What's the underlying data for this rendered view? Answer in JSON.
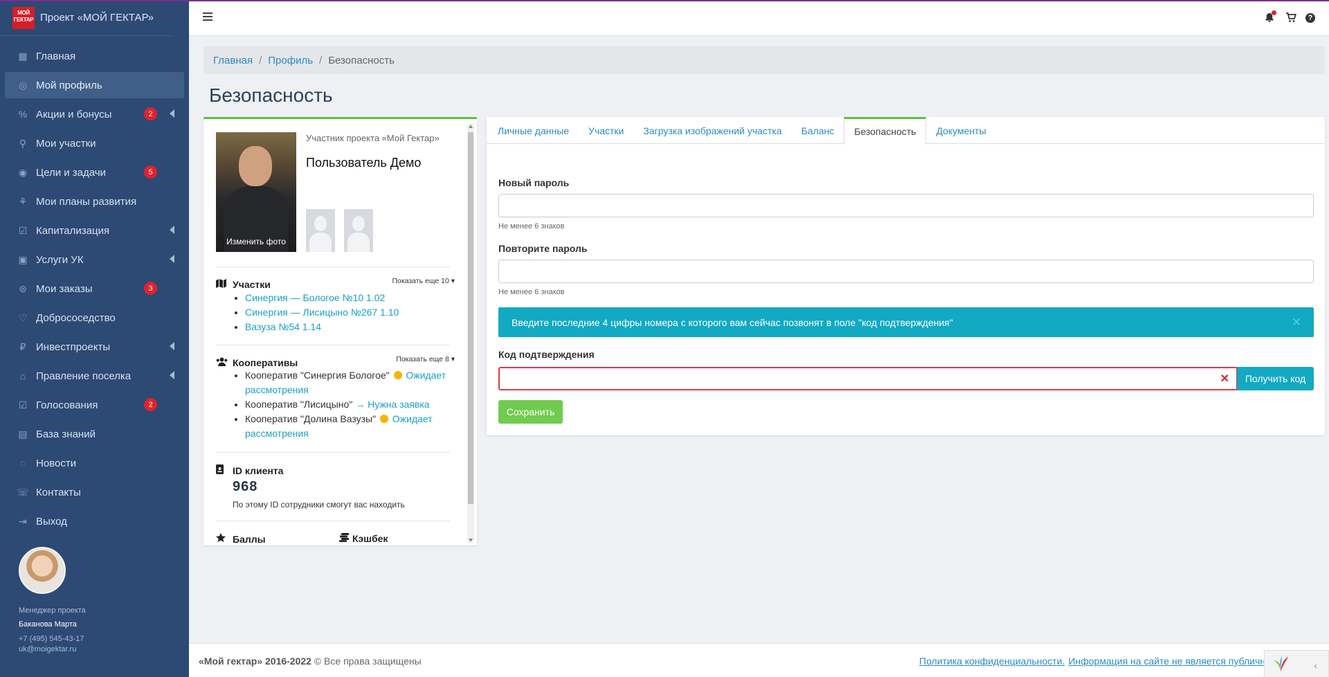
{
  "brand": {
    "title": "Проект «МОЙ ГЕКТАР»",
    "logo_text_1": "МОЙ",
    "logo_text_2": "ГЕКТАР",
    "logo_color": "#d51e28"
  },
  "sidebar": {
    "items": [
      {
        "label": "Главная",
        "icon": "grid-icon"
      },
      {
        "label": "Мой профиль",
        "icon": "user-circle-icon",
        "active": true
      },
      {
        "label": "Акции и бонусы",
        "icon": "percent-icon",
        "badge": "2",
        "chevron": true
      },
      {
        "label": "Мои участки",
        "icon": "map-pin-icon"
      },
      {
        "label": "Цели и задачи",
        "icon": "target-icon",
        "badge": "5"
      },
      {
        "label": "Мои планы развития",
        "icon": "growth-icon"
      },
      {
        "label": "Капитализация",
        "icon": "checkbox-icon",
        "chevron": true
      },
      {
        "label": "Услуги УК",
        "icon": "briefcase-icon",
        "chevron": true
      },
      {
        "label": "Мои заказы",
        "icon": "orders-icon",
        "badge": "3"
      },
      {
        "label": "Добрососедство",
        "icon": "handshake-icon"
      },
      {
        "label": "Инвестпроекты",
        "icon": "rouble-icon",
        "chevron": true
      },
      {
        "label": "Правление поселка",
        "icon": "building-icon",
        "chevron": true
      },
      {
        "label": "Голосования",
        "icon": "vote-icon",
        "badge": "2"
      },
      {
        "label": "База знаний",
        "icon": "book-icon"
      },
      {
        "label": "Новости",
        "icon": "news-icon"
      },
      {
        "label": "Контакты",
        "icon": "phone-icon"
      },
      {
        "label": "Выход",
        "icon": "logout-icon"
      }
    ],
    "manager": {
      "role": "Менеджер проекта",
      "name": "Баканова Марта",
      "phone": "+7 (495) 545-43-17",
      "email": "uk@moigektar.ru"
    }
  },
  "header": {
    "icons": [
      "menu-icon",
      "bell-icon",
      "cart-icon",
      "help-icon"
    ]
  },
  "breadcrumb": {
    "items": [
      "Главная",
      "Профиль"
    ],
    "current": "Безопасность"
  },
  "page_title": "Безопасность",
  "profile": {
    "change_photo": "Изменить фото",
    "subtitle": "Участник проекта «Мой Гектар»",
    "name": "Пользователь Демо",
    "plots": {
      "title": "Участки",
      "show_more": "Показать еще 10",
      "items": [
        "Синергия — Бологое №10 1.02",
        "Синергия — Лисицыно №267 1.10",
        "Вазуза №54 1.14"
      ]
    },
    "coops": {
      "title": "Кооперативы",
      "show_more": "Показать еще 8",
      "items": [
        {
          "name": "Кооператив \"Синергия Бологое\"",
          "status": "Ожидает рассмотрения",
          "status_icon": "clock-icon"
        },
        {
          "name": "Кооператив \"Лисицыно\"",
          "status": "Нужна заявка",
          "status_icon": "arrow-right-icon"
        },
        {
          "name": "Кооператив \"Долина Вазузы\"",
          "status": "Ожидает рассмотрения",
          "status_icon": "clock-icon"
        }
      ]
    },
    "client": {
      "title": "ID клиента",
      "id": "968",
      "note": "По этому ID сотрудники смогут вас находить"
    },
    "points_label": "Баллы",
    "cashback_label": "Кэшбек"
  },
  "tabs": [
    "Личные данные",
    "Участки",
    "Загрузка изображений участка",
    "Баланс",
    "Безопасность",
    "Документы"
  ],
  "active_tab": "Безопасность",
  "form": {
    "new_password_label": "Новый пароль",
    "new_password_value": "",
    "new_password_help": "Не менее 6 знаков",
    "repeat_password_label": "Повторите пароль",
    "repeat_password_value": "",
    "repeat_password_help": "Не менее 6 знаков",
    "alert": "Введите последние 4 цифры номера с которого вам сейчас позвонят в поле \"код подтверждения\"",
    "code_label": "Код подтверждения",
    "code_value": "",
    "get_code": "Получить код",
    "save": "Сохранить"
  },
  "footer": {
    "copyright_bold": "«Мой гектар» 2016-2022",
    "copyright_rest": "© Все права защищены",
    "privacy_link": "Политика конфиденциальности.",
    "info_link": "Информация на сайте не является публичной офертой"
  },
  "colors": {
    "sidebar": "#2c4a74",
    "accent_green": "#5cc241",
    "info": "#12a9c2",
    "badge": "#e1222c",
    "link": "#2b8bc6"
  }
}
